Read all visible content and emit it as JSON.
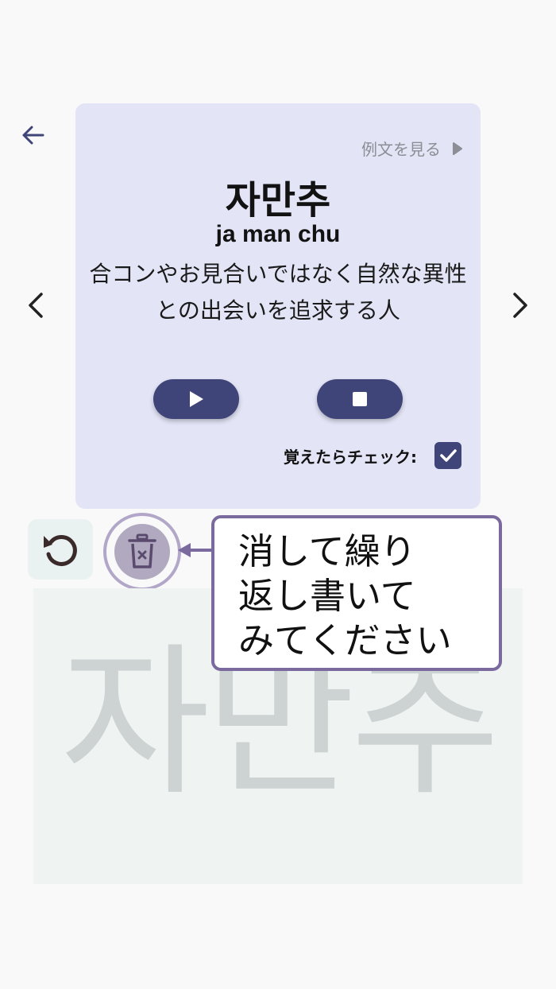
{
  "card": {
    "example_link": "例文を見る",
    "word": "자만추",
    "romanization": "ja man chu",
    "meaning": "合コンやお見合いではなく自然な異性との出会いを追求する人",
    "check_label": "覚えたらチェック:",
    "checked": true
  },
  "practice": {
    "trace_text": "자만추",
    "tooltip": "消して繰り\n返し書いて\nみてください"
  },
  "icons": {
    "back": "arrow-left-icon",
    "prev": "chevron-left-icon",
    "next": "chevron-right-icon",
    "example": "triangle-right-icon",
    "play": "play-icon",
    "stop": "stop-icon",
    "check": "checkmark-icon",
    "undo": "undo-icon",
    "clear": "trash-icon"
  },
  "colors": {
    "card_bg": "#e3e5f7",
    "accent": "#3f4578",
    "tooltip_border": "#7b6a9e",
    "canvas_bg": "#eff4f3",
    "trace_text": "#cdd3d2"
  }
}
